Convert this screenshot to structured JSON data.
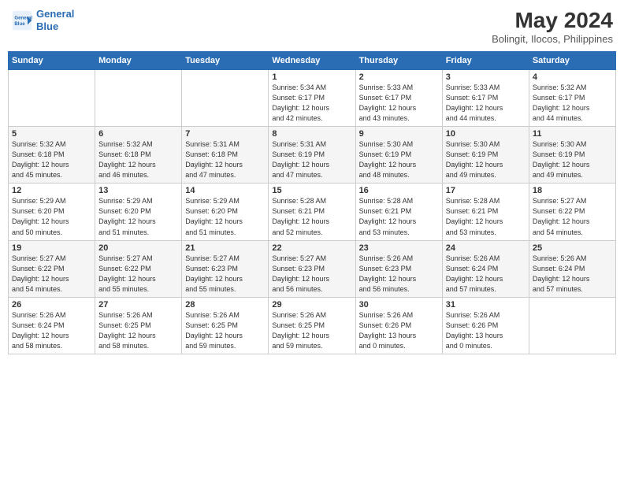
{
  "header": {
    "logo_line1": "General",
    "logo_line2": "Blue",
    "title": "May 2024",
    "subtitle": "Bolingit, Ilocos, Philippines"
  },
  "days_of_week": [
    "Sunday",
    "Monday",
    "Tuesday",
    "Wednesday",
    "Thursday",
    "Friday",
    "Saturday"
  ],
  "weeks": [
    [
      {
        "day": "",
        "info": ""
      },
      {
        "day": "",
        "info": ""
      },
      {
        "day": "",
        "info": ""
      },
      {
        "day": "1",
        "info": "Sunrise: 5:34 AM\nSunset: 6:17 PM\nDaylight: 12 hours\nand 42 minutes."
      },
      {
        "day": "2",
        "info": "Sunrise: 5:33 AM\nSunset: 6:17 PM\nDaylight: 12 hours\nand 43 minutes."
      },
      {
        "day": "3",
        "info": "Sunrise: 5:33 AM\nSunset: 6:17 PM\nDaylight: 12 hours\nand 44 minutes."
      },
      {
        "day": "4",
        "info": "Sunrise: 5:32 AM\nSunset: 6:17 PM\nDaylight: 12 hours\nand 44 minutes."
      }
    ],
    [
      {
        "day": "5",
        "info": "Sunrise: 5:32 AM\nSunset: 6:18 PM\nDaylight: 12 hours\nand 45 minutes."
      },
      {
        "day": "6",
        "info": "Sunrise: 5:32 AM\nSunset: 6:18 PM\nDaylight: 12 hours\nand 46 minutes."
      },
      {
        "day": "7",
        "info": "Sunrise: 5:31 AM\nSunset: 6:18 PM\nDaylight: 12 hours\nand 47 minutes."
      },
      {
        "day": "8",
        "info": "Sunrise: 5:31 AM\nSunset: 6:19 PM\nDaylight: 12 hours\nand 47 minutes."
      },
      {
        "day": "9",
        "info": "Sunrise: 5:30 AM\nSunset: 6:19 PM\nDaylight: 12 hours\nand 48 minutes."
      },
      {
        "day": "10",
        "info": "Sunrise: 5:30 AM\nSunset: 6:19 PM\nDaylight: 12 hours\nand 49 minutes."
      },
      {
        "day": "11",
        "info": "Sunrise: 5:30 AM\nSunset: 6:19 PM\nDaylight: 12 hours\nand 49 minutes."
      }
    ],
    [
      {
        "day": "12",
        "info": "Sunrise: 5:29 AM\nSunset: 6:20 PM\nDaylight: 12 hours\nand 50 minutes."
      },
      {
        "day": "13",
        "info": "Sunrise: 5:29 AM\nSunset: 6:20 PM\nDaylight: 12 hours\nand 51 minutes."
      },
      {
        "day": "14",
        "info": "Sunrise: 5:29 AM\nSunset: 6:20 PM\nDaylight: 12 hours\nand 51 minutes."
      },
      {
        "day": "15",
        "info": "Sunrise: 5:28 AM\nSunset: 6:21 PM\nDaylight: 12 hours\nand 52 minutes."
      },
      {
        "day": "16",
        "info": "Sunrise: 5:28 AM\nSunset: 6:21 PM\nDaylight: 12 hours\nand 53 minutes."
      },
      {
        "day": "17",
        "info": "Sunrise: 5:28 AM\nSunset: 6:21 PM\nDaylight: 12 hours\nand 53 minutes."
      },
      {
        "day": "18",
        "info": "Sunrise: 5:27 AM\nSunset: 6:22 PM\nDaylight: 12 hours\nand 54 minutes."
      }
    ],
    [
      {
        "day": "19",
        "info": "Sunrise: 5:27 AM\nSunset: 6:22 PM\nDaylight: 12 hours\nand 54 minutes."
      },
      {
        "day": "20",
        "info": "Sunrise: 5:27 AM\nSunset: 6:22 PM\nDaylight: 12 hours\nand 55 minutes."
      },
      {
        "day": "21",
        "info": "Sunrise: 5:27 AM\nSunset: 6:23 PM\nDaylight: 12 hours\nand 55 minutes."
      },
      {
        "day": "22",
        "info": "Sunrise: 5:27 AM\nSunset: 6:23 PM\nDaylight: 12 hours\nand 56 minutes."
      },
      {
        "day": "23",
        "info": "Sunrise: 5:26 AM\nSunset: 6:23 PM\nDaylight: 12 hours\nand 56 minutes."
      },
      {
        "day": "24",
        "info": "Sunrise: 5:26 AM\nSunset: 6:24 PM\nDaylight: 12 hours\nand 57 minutes."
      },
      {
        "day": "25",
        "info": "Sunrise: 5:26 AM\nSunset: 6:24 PM\nDaylight: 12 hours\nand 57 minutes."
      }
    ],
    [
      {
        "day": "26",
        "info": "Sunrise: 5:26 AM\nSunset: 6:24 PM\nDaylight: 12 hours\nand 58 minutes."
      },
      {
        "day": "27",
        "info": "Sunrise: 5:26 AM\nSunset: 6:25 PM\nDaylight: 12 hours\nand 58 minutes."
      },
      {
        "day": "28",
        "info": "Sunrise: 5:26 AM\nSunset: 6:25 PM\nDaylight: 12 hours\nand 59 minutes."
      },
      {
        "day": "29",
        "info": "Sunrise: 5:26 AM\nSunset: 6:25 PM\nDaylight: 12 hours\nand 59 minutes."
      },
      {
        "day": "30",
        "info": "Sunrise: 5:26 AM\nSunset: 6:26 PM\nDaylight: 13 hours\nand 0 minutes."
      },
      {
        "day": "31",
        "info": "Sunrise: 5:26 AM\nSunset: 6:26 PM\nDaylight: 13 hours\nand 0 minutes."
      },
      {
        "day": "",
        "info": ""
      }
    ]
  ]
}
